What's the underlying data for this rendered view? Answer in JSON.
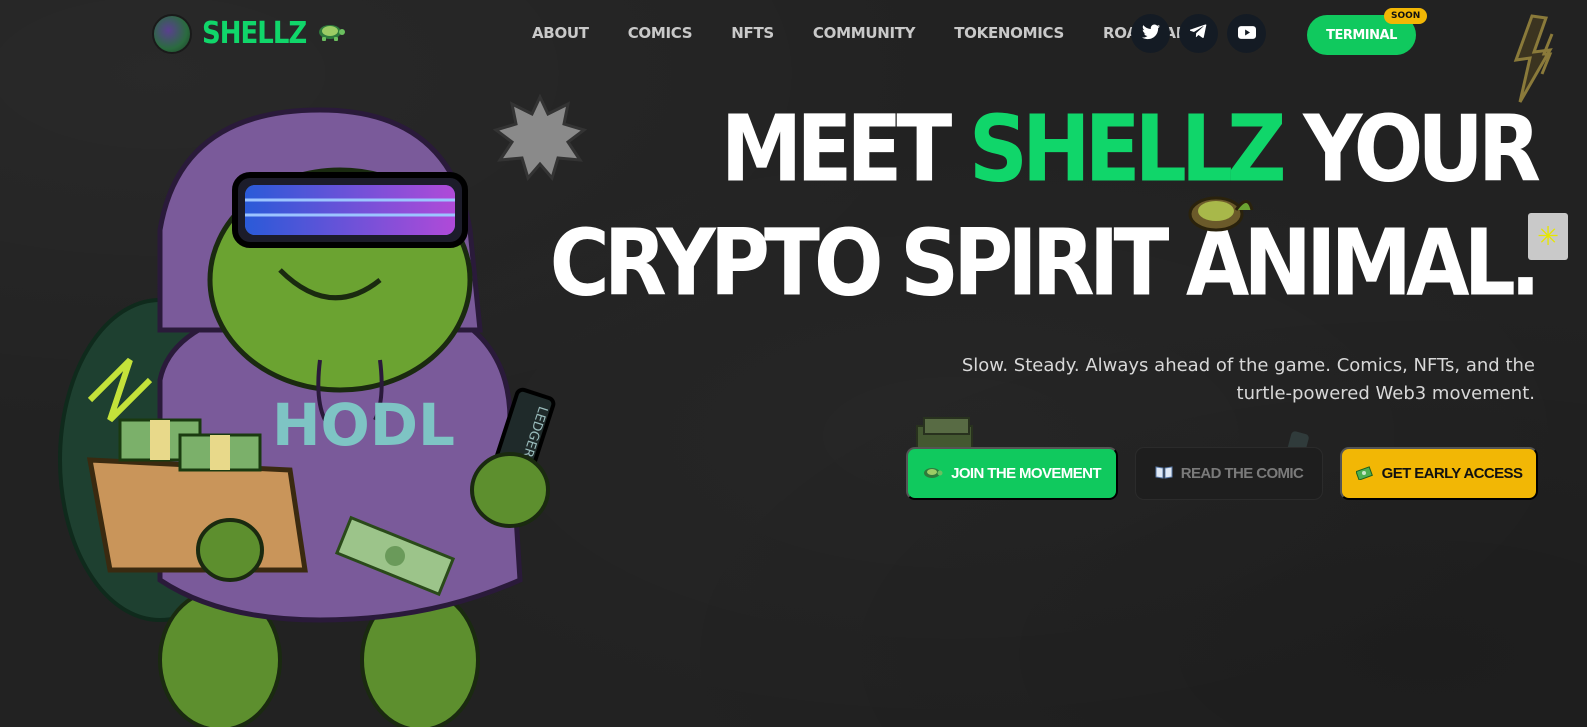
{
  "brand": {
    "name": "SHELLZ"
  },
  "nav": {
    "links": [
      "ABOUT",
      "COMICS",
      "NFTS",
      "COMMUNITY",
      "TOKENOMICS",
      "ROADMAP"
    ],
    "socials": [
      "twitter-icon",
      "telegram-icon",
      "youtube-icon"
    ],
    "terminal_label": "TERMINAL",
    "soon_badge": "SOON"
  },
  "hero": {
    "title_line1_a": "MEET ",
    "title_line1_highlight": "SHELLZ",
    "title_line1_b": " YOUR",
    "title_line2": "CRYPTO SPIRIT ANIMAL.",
    "subtitle_line1": "Slow. Steady. Always ahead of the game. Comics, NFTs, and the",
    "subtitle_line2": "turtle-powered Web3 movement.",
    "mascot_shirt_text": "HODL",
    "mascot_device_text": "LEDGER",
    "cta": {
      "join": "JOIN THE MOVEMENT",
      "read": "READ THE COMIC",
      "early": "GET EARLY ACCESS"
    }
  },
  "colors": {
    "background": "#222222",
    "accent_green": "#10d66a",
    "button_green": "#10c95e",
    "accent_yellow": "#f2b705"
  }
}
